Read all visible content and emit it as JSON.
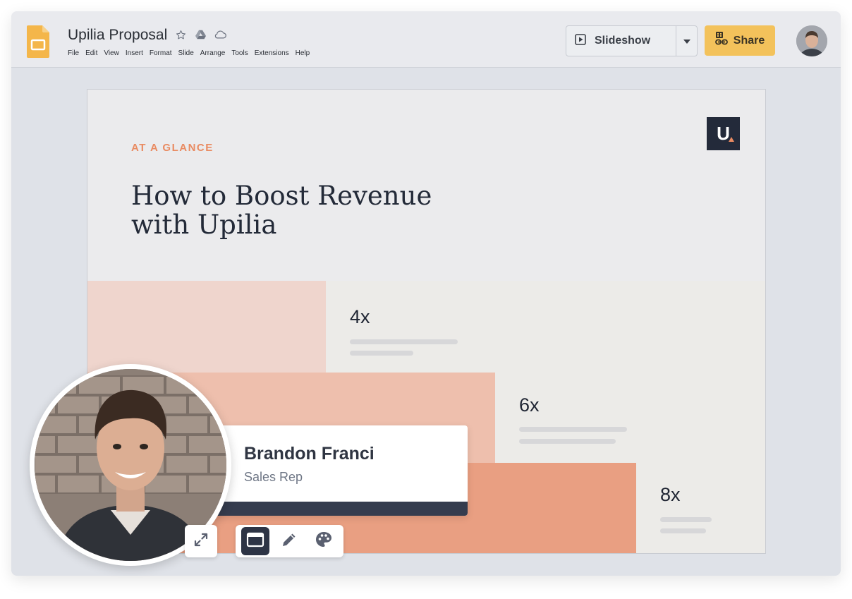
{
  "app": {
    "title": "Upilia Proposal",
    "menu": [
      "File",
      "Edit",
      "View",
      "Insert",
      "Format",
      "Slide",
      "Arrange",
      "Tools",
      "Extensions",
      "Help"
    ],
    "slideshow_label": "Slideshow",
    "share_label": "Share",
    "colors": {
      "share_button": "#f3c25b",
      "accent_orange": "#e98b62",
      "dark_navy": "#232a3a",
      "doc_icon_yellow": "#f4b64a"
    },
    "title_icons": [
      "star-icon",
      "drive-icon",
      "cloud-icon"
    ]
  },
  "slide": {
    "eyebrow": "AT A GLANCE",
    "headline_line1": "How to Boost Revenue",
    "headline_line2": "with Upilia",
    "logo_text": "U",
    "stats": [
      {
        "value": "4x"
      },
      {
        "value": "6x"
      },
      {
        "value": "8x"
      }
    ]
  },
  "presenter": {
    "name": "Brandon Franci",
    "role": "Sales Rep"
  },
  "controls": {
    "expand": "expand-icon",
    "layout": "window-layout-icon",
    "pen": "pencil-icon",
    "palette": "palette-icon"
  }
}
